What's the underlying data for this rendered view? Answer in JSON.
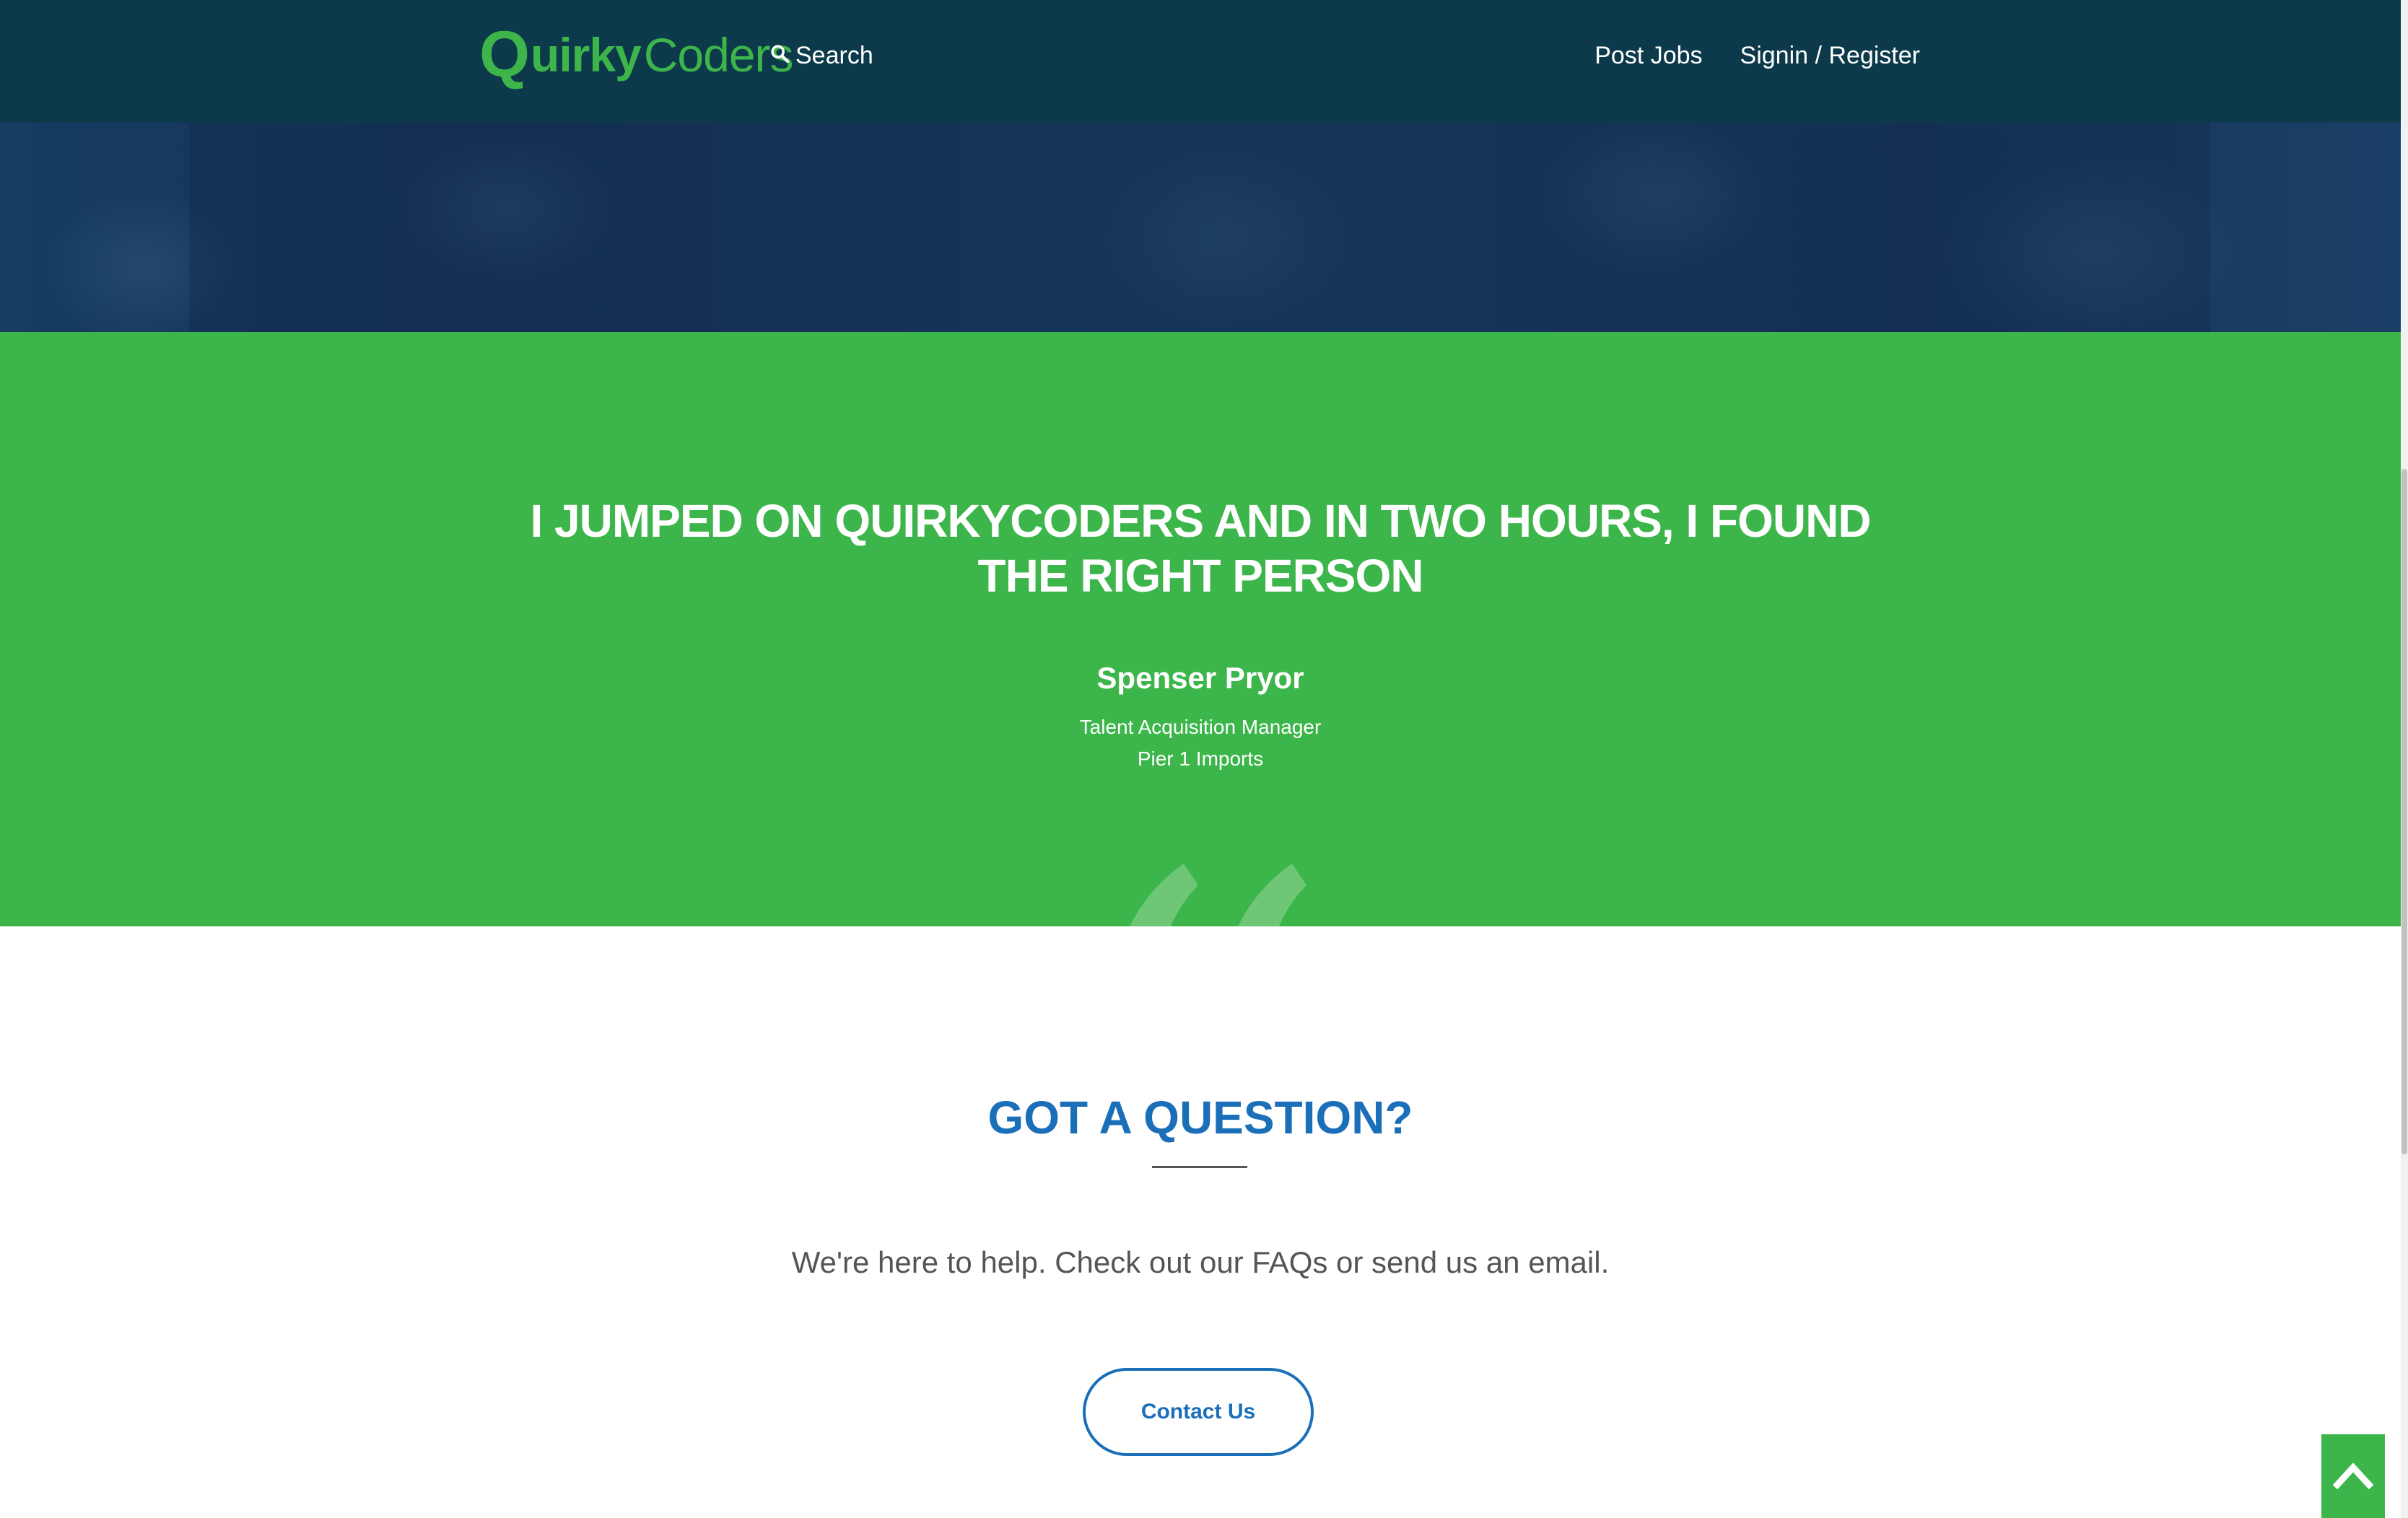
{
  "header": {
    "logo": {
      "q": "Q",
      "uirky": "uirky",
      "coders": "Coders"
    },
    "search_label": "Search",
    "nav": {
      "post_jobs": "Post Jobs",
      "signin_register": "Signin / Register"
    }
  },
  "testimonial": {
    "quote_line1": "I JUMPED ON QUIRKYCODERS AND IN TWO HOURS, I FOUND",
    "quote_line2": "THE RIGHT PERSON",
    "name": "Spenser Pryor",
    "role": "Talent Acquisition Manager",
    "company": "Pier 1 Imports"
  },
  "question": {
    "title": "GOT A QUESTION?",
    "text": "We're here to help. Check out our FAQs or send us an email.",
    "button_label": "Contact Us"
  },
  "icons": {
    "search": "search-icon",
    "quote": "quote-mark-icon",
    "back_to_top": "chevron-up-icon"
  },
  "colors": {
    "header_bg": "#0c3a4b",
    "brand_green": "#3cb54a",
    "accent_blue": "#1a6fb8",
    "body_text": "#555555"
  }
}
